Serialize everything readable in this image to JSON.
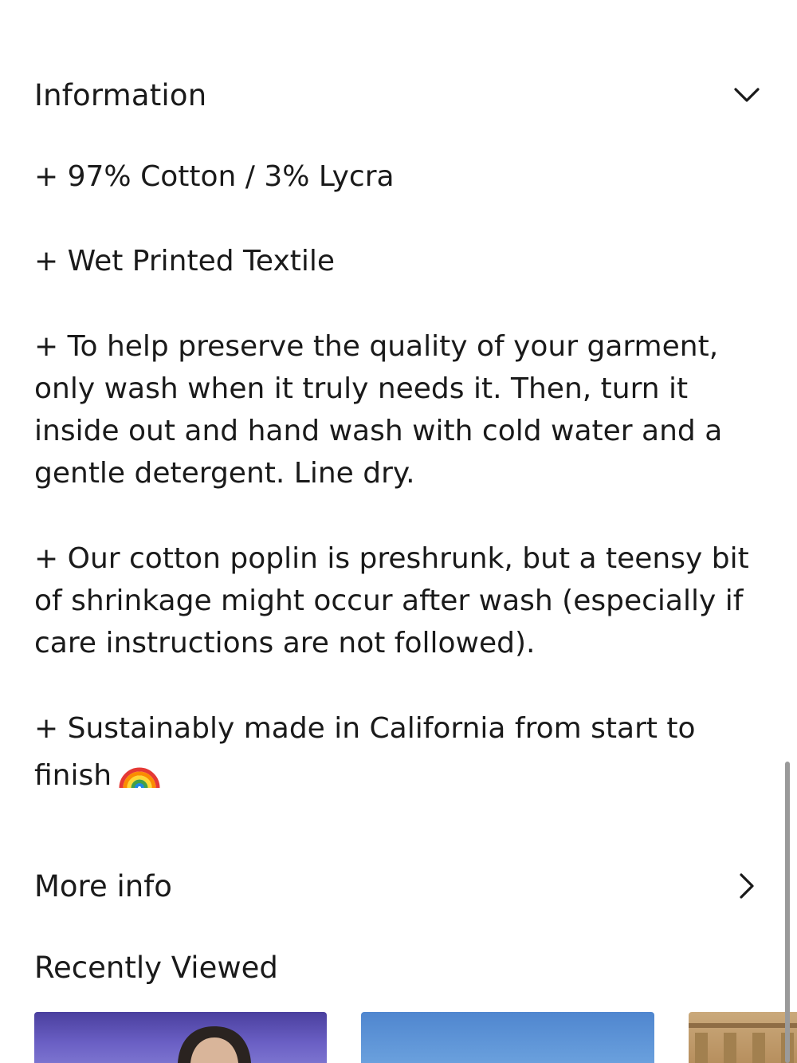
{
  "information": {
    "title": "Information",
    "toggle_icon": "chevron-down-icon",
    "details": [
      "+ 97% Cotton / 3% Lycra",
      "+ Wet Printed Textile",
      "+ To help preserve the quality of your garment, only wash when it truly needs it. Then, turn it inside out and hand wash with cold water and a gentle detergent. Line dry.",
      "+ Our cotton poplin is preshrunk, but a teensy bit of shrinkage might occur after wash (especially if care instructions are not followed).",
      "+ Sustainably made in California from start to finish"
    ],
    "last_detail_emoji": "rainbow-icon"
  },
  "more_info": {
    "label": "More info",
    "icon": "chevron-right-icon"
  },
  "recently_viewed": {
    "title": "Recently Viewed",
    "thumbnail_colors": [
      "#5b50b4",
      "#5f95d7",
      "#c29f70"
    ]
  },
  "colors": {
    "text": "#1a1a1a",
    "background": "#ffffff",
    "scrollbar": "#9a9a9a"
  }
}
